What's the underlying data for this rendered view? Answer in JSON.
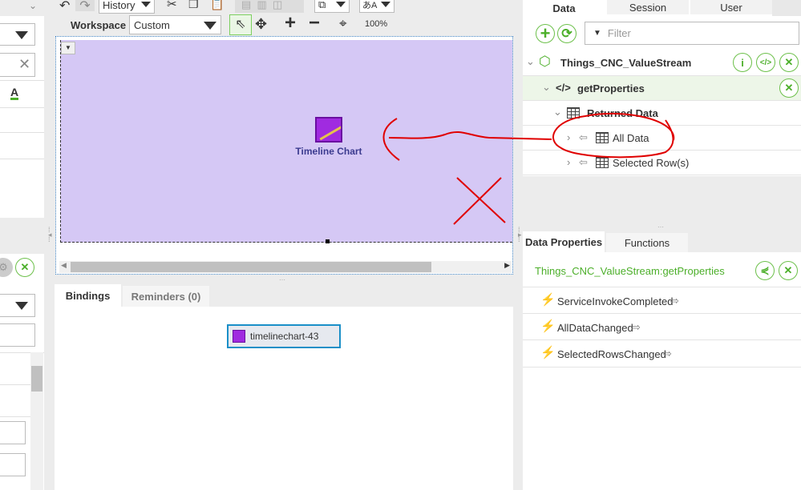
{
  "toolbar": {
    "history_label": "History",
    "workspace_label": "Workspace",
    "workspace_value": "Custom",
    "zoom": "100%"
  },
  "canvas": {
    "widget_label": "Timeline Chart"
  },
  "bottom": {
    "tabs": [
      "Bindings",
      "Reminders (0)"
    ],
    "binding_widget": "timelinechart-43"
  },
  "right": {
    "tabs": [
      "Data",
      "Session",
      "User"
    ],
    "filter_placeholder": "Filter",
    "tree": {
      "thing": "Things_CNC_ValueStream",
      "service": "getProperties",
      "returned": "Returned Data",
      "all_data": "All Data",
      "selected_rows": "Selected Row(s)"
    },
    "props_tabs": [
      "Data Properties",
      "Functions"
    ],
    "props_title": "Things_CNC_ValueStream:getProperties",
    "events": [
      "ServiceInvokeCompleted",
      "AllDataChanged",
      "SelectedRowsChanged"
    ]
  },
  "colors": {
    "accent": "#4caf2a",
    "canvas": "#d5c8f5",
    "annotation": "#e00000"
  }
}
